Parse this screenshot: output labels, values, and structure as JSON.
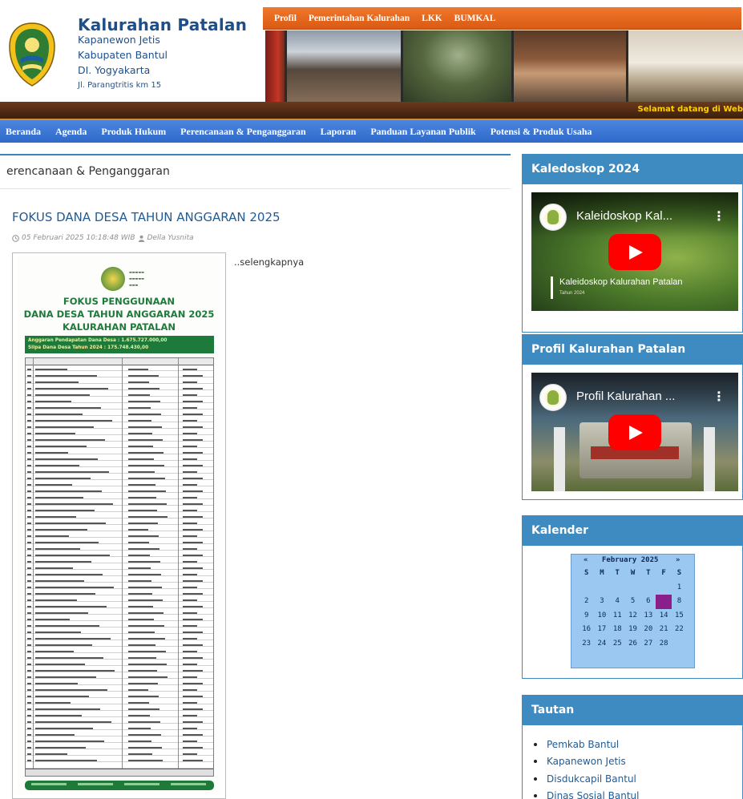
{
  "header": {
    "title": "Kalurahan Patalan",
    "lines": [
      "Kapanewon Jetis",
      "Kabupaten Bantul",
      "DI. Yogyakarta",
      "Jl. Parangtritis km 15"
    ]
  },
  "top_nav": [
    "Profil",
    "Pemerintahan Kalurahan",
    "LKK",
    "BUMKAL"
  ],
  "marquee": "Selamat datang di Web",
  "main_nav": [
    "Beranda",
    "Agenda",
    "Produk Hukum",
    "Perencanaan & Penganggaran",
    "Laporan",
    "Panduan Layanan Publik",
    "Potensi & Produk Usaha"
  ],
  "page": {
    "heading": "erencanaan & Penganggaran"
  },
  "post": {
    "title": "FOKUS DANA DESA TAHUN ANGGARAN 2025",
    "date": "05 Februari 2025 10:18:48 WIB",
    "author": "Della Yusnita",
    "read_more": "..selengkapnya",
    "poster": {
      "title_line1": "FOKUS PENGGUNAAN",
      "title_line2": "DANA DESA TAHUN ANGGARAN 2025",
      "title_line3": "KALURAHAN PATALAN",
      "band_line1": "Anggaran Pendapatan Dana Desa : 1.675.727.000,00",
      "band_line2": "Silpa Dana Desa Tahun 2024        :    175.748.430,00"
    }
  },
  "sidebar": {
    "widgets": [
      {
        "title": "Kaledoskop 2024",
        "video_title": "Kaleidoskop Kal...",
        "caption": "Kaleidoskop Kalurahan Patalan",
        "caption_sub": "Tahun 2024"
      },
      {
        "title": "Profil Kalurahan Patalan",
        "video_title": "Profil Kalurahan ..."
      }
    ],
    "calendar": {
      "title": "Kalender",
      "prev": "«",
      "next": "»",
      "month_label": "February 2025",
      "day_names": [
        "S",
        "M",
        "T",
        "W",
        "T",
        "F",
        "S"
      ],
      "rows": [
        [
          "",
          "",
          "",
          "",
          "",
          "",
          "1"
        ],
        [
          "2",
          "3",
          "4",
          "5",
          "6",
          "7",
          "8"
        ],
        [
          "9",
          "10",
          "11",
          "12",
          "13",
          "14",
          "15"
        ],
        [
          "16",
          "17",
          "18",
          "19",
          "20",
          "21",
          "22"
        ],
        [
          "23",
          "24",
          "25",
          "26",
          "27",
          "28",
          ""
        ]
      ],
      "highlighted_day": "7"
    },
    "links": {
      "title": "Tautan",
      "items": [
        "Pemkab Bantul",
        "Kapanewon Jetis",
        "Disdukcapil Bantul",
        "Dinas Sosial Bantul"
      ]
    }
  },
  "colors": {
    "top_nav": "#e06a1e",
    "main_nav": "#3a76d6",
    "widget_header": "#3d8bc0",
    "link": "#1f5b95",
    "title_blue": "#1e4f8a",
    "poster_green": "#1e7a3b",
    "calendar_bg": "#9bc8f0",
    "today": "#8a1f8c"
  }
}
